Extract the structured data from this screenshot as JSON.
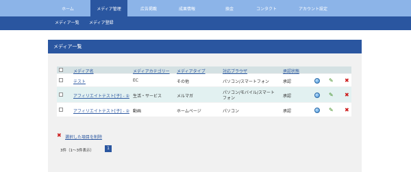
{
  "topnav": {
    "tabs": [
      {
        "label": "ホーム"
      },
      {
        "label": "メディア管理"
      },
      {
        "label": "広告掲載"
      },
      {
        "label": "成果情報"
      },
      {
        "label": "換金"
      },
      {
        "label": "コンタクト"
      },
      {
        "label": "アカウント設定"
      }
    ],
    "active_index": 1
  },
  "subnav": {
    "items": [
      {
        "label": "メディア一覧"
      },
      {
        "label": "メディア登録"
      }
    ]
  },
  "panel": {
    "title": "メディア一覧"
  },
  "table": {
    "headers": {
      "name": "メディア名",
      "category": "メディアカテゴリー",
      "type": "メディアタイプ",
      "browser": "対応ブラウザ",
      "status": "承認状態"
    },
    "rows": [
      {
        "name": "テスト",
        "category": "EC",
        "type": "その他",
        "browser_line1": "パソコン/スマートフォン",
        "browser_line2": "",
        "status": "承認"
      },
      {
        "name": "アフィリエイトテスト[子] - ①",
        "category": "生活・サービス",
        "type": "メルマガ",
        "browser_line1": "パソコン/モバイル/スマート",
        "browser_line2": "フォン",
        "status": "承認"
      },
      {
        "name": "アフィリエイトテスト[子] - ②",
        "category": "動画",
        "type": "ホームページ",
        "browser_line1": "パソコン",
        "browser_line2": "",
        "status": "承認"
      }
    ],
    "row_icons": [
      "globe-icon",
      "pencil-icon",
      "delete-x-icon"
    ]
  },
  "actions": {
    "delete_selected": "選択した項目を削除"
  },
  "pagination": {
    "count_text": "3件（1～3件表示）",
    "current_page": "1"
  },
  "colors": {
    "nav_light": "#8cb4e8",
    "nav_dark": "#2a56a0",
    "header_row": "#d4e1e3",
    "row_alt": "#e2f1f1",
    "delete_red": "#cc1a1a",
    "edit_green": "#3a8a1c"
  }
}
